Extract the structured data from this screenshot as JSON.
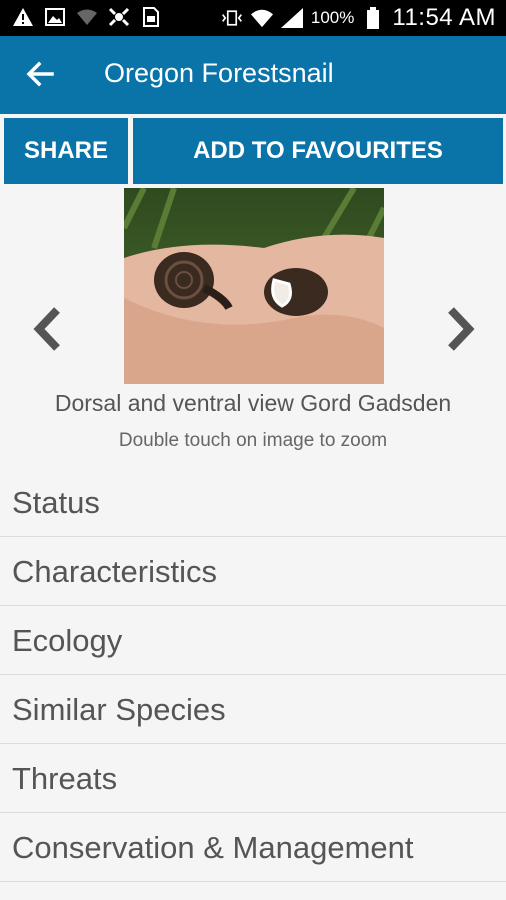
{
  "status_bar": {
    "battery_percent": "100%",
    "time": "11:54 AM",
    "icons": [
      "warning-icon",
      "image-icon",
      "wifi-off-icon",
      "usb-icon",
      "sim-icon",
      "vibrate-icon",
      "wifi-icon",
      "signal-icon",
      "battery-icon"
    ]
  },
  "app_bar": {
    "title": "Oregon Forestsnail",
    "back_icon": "arrow-left-icon"
  },
  "actions": {
    "share_label": "SHARE",
    "favourites_label": "ADD TO FAVOURITES"
  },
  "gallery": {
    "caption": "Dorsal and ventral view Gord Gadsden",
    "hint": "Double touch on image to zoom"
  },
  "sections": [
    {
      "label": "Status"
    },
    {
      "label": "Characteristics"
    },
    {
      "label": "Ecology"
    },
    {
      "label": "Similar Species"
    },
    {
      "label": "Threats"
    },
    {
      "label": "Conservation & Management"
    }
  ],
  "colors": {
    "primary": "#0a73a8",
    "background": "#f5f5f5",
    "text": "#555555"
  }
}
